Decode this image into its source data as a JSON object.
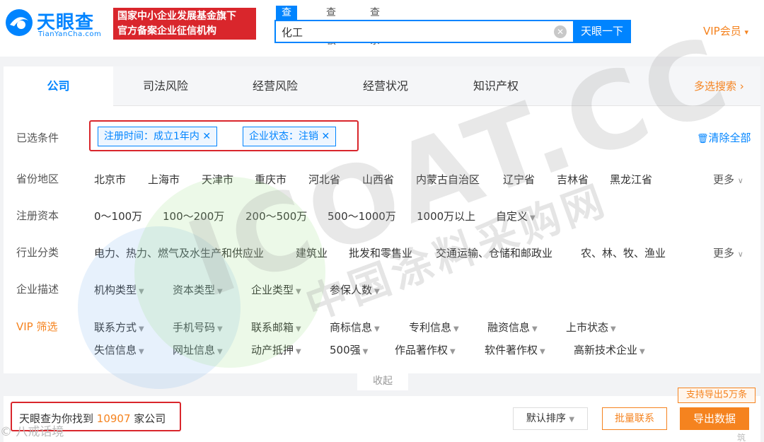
{
  "header": {
    "logo_cn": "天眼查",
    "logo_en": "TianYanCha.com",
    "badge_line1": "国家中小企业发展基金旗下",
    "badge_line2": "官方备案企业征信机构",
    "search_tabs": [
      "查公司",
      "查老板",
      "查关系"
    ],
    "search_value": "化工",
    "search_button": "天眼一下",
    "vip": "VIP会员"
  },
  "tabs": [
    "公司",
    "司法风险",
    "经营风险",
    "经营状况",
    "知识产权"
  ],
  "multi_search": "多选搜索",
  "selected": {
    "label": "已选条件",
    "chips": [
      "注册时间：成立1年内",
      "企业状态：注销"
    ],
    "clear_all": "清除全部"
  },
  "province": {
    "label": "省份地区",
    "items": [
      "北京市",
      "上海市",
      "天津市",
      "重庆市",
      "河北省",
      "山西省",
      "内蒙古自治区",
      "辽宁省",
      "吉林省",
      "黑龙江省"
    ],
    "more": "更多"
  },
  "capital": {
    "label": "注册资本",
    "items": [
      "0～100万",
      "100～200万",
      "200～500万",
      "500～1000万",
      "1000万以上",
      "自定义"
    ]
  },
  "industry": {
    "label": "行业分类",
    "items": [
      "电力、热力、燃气及水生产和供应业",
      "建筑业",
      "批发和零售业",
      "交通运输、仓储和邮政业",
      "农、林、牧、渔业"
    ],
    "more": "更多"
  },
  "desc": {
    "label": "企业描述",
    "items": [
      "机构类型",
      "资本类型",
      "企业类型",
      "参保人数"
    ]
  },
  "vip_filter": {
    "label": "VIP 筛选",
    "row1": [
      "联系方式",
      "手机号码",
      "联系邮箱",
      "商标信息",
      "专利信息",
      "融资信息",
      "上市状态"
    ],
    "row2": [
      "失信信息",
      "网址信息",
      "动产抵押",
      "500强",
      "作品著作权",
      "软件著作权",
      "高新技术企业"
    ]
  },
  "collapse": "收起",
  "result": {
    "prefix": "天眼查为你找到",
    "count": "10907",
    "suffix": "家公司",
    "sort": "默认排序",
    "batch": "批量联系",
    "export": "导出数据",
    "export_tip": "支持导出5万条"
  },
  "watermark": {
    "big": "ICOAT.CC",
    "cn": "中国涂料采购网",
    "corner": "© 八戒话境",
    "corner2": "筑"
  },
  "colors": {
    "accent": "#0084ff",
    "orange": "#f5831f",
    "red": "#d9262c"
  }
}
